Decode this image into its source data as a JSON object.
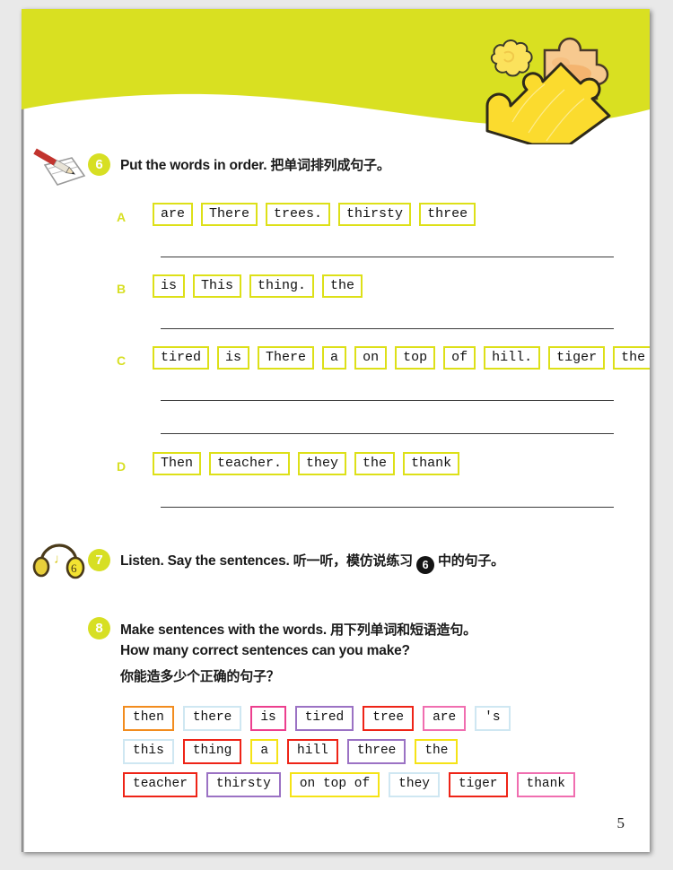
{
  "page": {
    "number": "5",
    "header_color": "#d9e021",
    "accent_color": "#d7df23"
  },
  "exercise6": {
    "badge": "6",
    "icon": "pencil-writing-icon",
    "title_en": "Put the words in order.",
    "title_cn": "把单词排列成句子。",
    "rows": [
      {
        "letter": "A",
        "words": [
          "are",
          "There",
          "trees.",
          "thirsty",
          "three"
        ],
        "lines": 1
      },
      {
        "letter": "B",
        "words": [
          "is",
          "This",
          "thing.",
          "the"
        ],
        "lines": 1
      },
      {
        "letter": "C",
        "words": [
          "tired",
          "is",
          "There",
          "a",
          "on",
          "top",
          "of",
          "hill.",
          "tiger",
          "the"
        ],
        "lines": 2
      },
      {
        "letter": "D",
        "words": [
          "Then",
          "teacher.",
          "they",
          "the",
          "thank"
        ],
        "lines": 1
      }
    ]
  },
  "exercise7": {
    "badge": "7",
    "icon": "headphones-icon",
    "title_en": "Listen. Say the sentences.",
    "title_cn_pre": "听一听，模仿说练习",
    "inline_ref": "6",
    "title_cn_post": "中的句子。"
  },
  "exercise8": {
    "badge": "8",
    "title_en_line1": "Make sentences with the words.",
    "title_cn_line1": "用下列单词和短语造句。",
    "title_en_line2": "How many correct sentences can you make?",
    "title_cn_line2": "你能造多少个正确的句子？",
    "bank_rows": [
      [
        {
          "text": "then",
          "color": "#f28c1e"
        },
        {
          "text": "there",
          "color": "#cfe7f2"
        },
        {
          "text": "is",
          "color": "#ec3f8e"
        },
        {
          "text": "tired",
          "color": "#9b72c4"
        },
        {
          "text": "tree",
          "color": "#ee2417"
        },
        {
          "text": "are",
          "color": "#f06eb0"
        },
        {
          "text": "'s",
          "color": "#cfe7f2"
        }
      ],
      [
        {
          "text": "this",
          "color": "#cfe7f2"
        },
        {
          "text": "thing",
          "color": "#ee2417"
        },
        {
          "text": "a",
          "color": "#f5e316"
        },
        {
          "text": "hill",
          "color": "#ee2417"
        },
        {
          "text": "three",
          "color": "#9b72c4"
        },
        {
          "text": "the",
          "color": "#f5e316"
        }
      ],
      [
        {
          "text": "teacher",
          "color": "#ee2417"
        },
        {
          "text": "thirsty",
          "color": "#9b72c4"
        },
        {
          "text": "on top of",
          "color": "#f5e316"
        },
        {
          "text": "they",
          "color": "#cfe7f2"
        },
        {
          "text": "tiger",
          "color": "#ee2417"
        },
        {
          "text": "thank",
          "color": "#f06eb0"
        }
      ]
    ]
  }
}
